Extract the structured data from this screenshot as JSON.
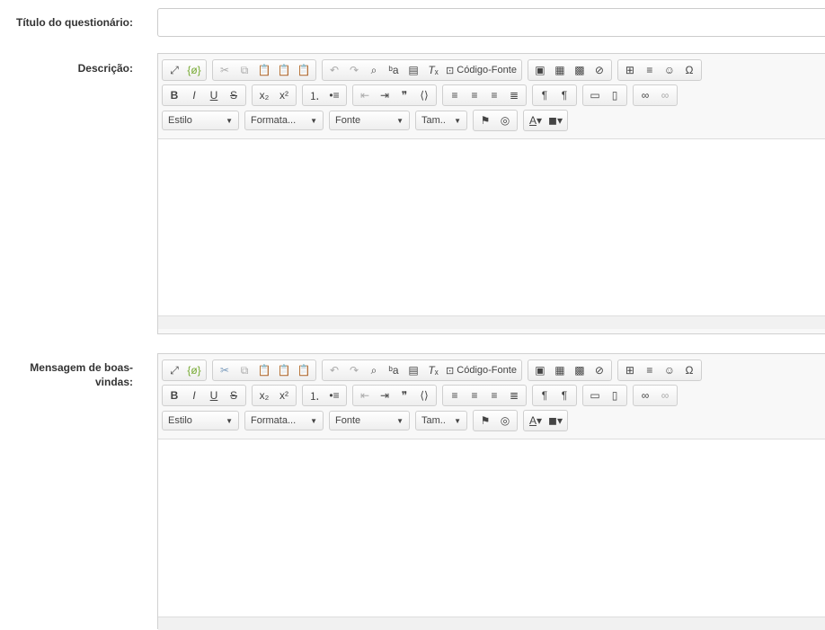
{
  "fields": {
    "title_label": "Título do questionário:",
    "title_value": "",
    "description_label": "Descrição:",
    "welcome_label_line1": "Mensagem de boas-",
    "welcome_label_line2": "vindas:"
  },
  "toolbar": {
    "source_label": "Código-Fonte",
    "style_combo": "Estilo",
    "format_combo": "Formata...",
    "font_combo": "Fonte",
    "size_combo": "Tam..",
    "bold": "B",
    "italic": "I",
    "underline": "U",
    "strike": "S",
    "subscript": "x₂",
    "superscript": "x²"
  },
  "icons": [
    "maximize-icon",
    "show-blocks-icon",
    "cut-icon",
    "copy-icon",
    "paste-icon",
    "paste-text-icon",
    "paste-word-icon",
    "undo-icon",
    "redo-icon",
    "find-icon",
    "replace-icon",
    "select-all-icon",
    "remove-format-icon",
    "source-icon",
    "image-icon",
    "flash-icon",
    "youtube-icon",
    "iframe-icon",
    "table-icon",
    "horizontal-rule-icon",
    "smiley-icon",
    "special-char-icon",
    "numbered-list-icon",
    "bulleted-list-icon",
    "outdent-icon",
    "indent-icon",
    "blockquote-icon",
    "div-icon",
    "align-left-icon",
    "align-center-icon",
    "align-right-icon",
    "justify-icon",
    "ltr-icon",
    "rtl-icon",
    "templates-icon",
    "new-page-icon",
    "link-icon",
    "unlink-icon",
    "anchor-icon",
    "language-icon",
    "text-color-icon",
    "background-color-icon"
  ]
}
